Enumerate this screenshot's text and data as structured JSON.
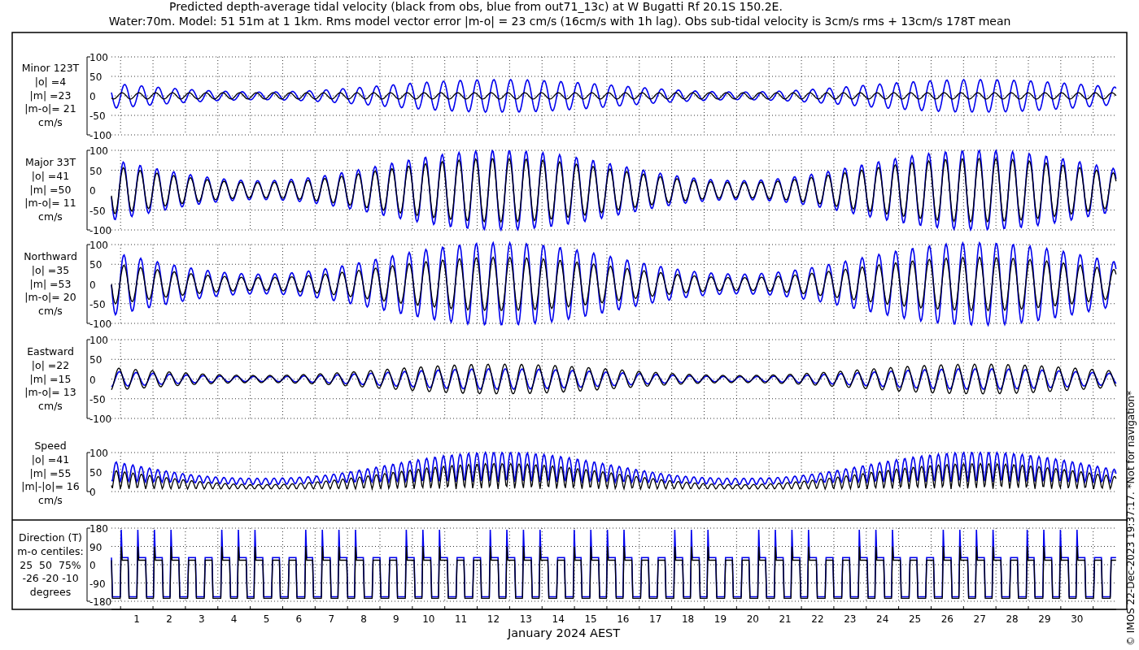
{
  "title": {
    "line_1": "Predicted depth-average tidal velocity (black from obs, blue from out71_13c) at W Bugatti Rf 20.1S 150.2E.",
    "line_2": "Water:70m. Model: 51 51m at 1 1km. Rms model vector error |m-o| = 23 cm/s (16cm/s with 1h lag). Obs sub-tidal velocity is 3cm/s rms + 13cm/s 178T mean"
  },
  "panels": [
    {
      "kind": "signed",
      "label_lines": [
        "Minor 123T",
        "|o| =4",
        "|m| =23",
        "|m-o|= 21",
        "cm/s"
      ],
      "yticks": [
        "100",
        "50",
        "0",
        "-50",
        "-100"
      ]
    },
    {
      "kind": "signed",
      "label_lines": [
        "Major 33T",
        "|o| =41",
        "|m| =50",
        "|m-o|= 11",
        "cm/s"
      ],
      "yticks": [
        "100",
        "50",
        "0",
        "-50",
        "-100"
      ]
    },
    {
      "kind": "signed",
      "label_lines": [
        "Northward",
        "|o| =35",
        "|m| =53",
        "|m-o|= 20",
        "cm/s"
      ],
      "yticks": [
        "100",
        "50",
        "0",
        "-50",
        "-100"
      ]
    },
    {
      "kind": "signed",
      "label_lines": [
        "Eastward",
        "|o| =22",
        "|m| =15",
        "|m-o|= 13",
        "cm/s"
      ],
      "yticks": [
        "100",
        "50",
        "0",
        "-50",
        "-100"
      ]
    },
    {
      "kind": "speed",
      "label_lines": [
        "Speed",
        "|o| =41",
        "|m| =55",
        "|m|-|o|= 16",
        "cm/s"
      ],
      "yticks": [
        "100",
        "50",
        "0"
      ]
    },
    {
      "kind": "direction",
      "label_lines": [
        "Direction (T)",
        "m-o centiles:",
        "25  50  75%",
        "-26 -20 -10",
        "degrees"
      ],
      "yticks": [
        "180",
        "90",
        "0",
        "-90",
        "-180"
      ]
    }
  ],
  "xaxis": {
    "ticks": [
      "1",
      "2",
      "3",
      "4",
      "5",
      "6",
      "7",
      "8",
      "9",
      "10",
      "11",
      "12",
      "13",
      "14",
      "15",
      "16",
      "17",
      "18",
      "19",
      "20",
      "21",
      "22",
      "23",
      "24",
      "25",
      "26",
      "27",
      "28",
      "29",
      "30"
    ],
    "label": "January 2024 AEST"
  },
  "imprint": "© IMOS 22-Dec-2023 19:37:17. *Not for navigation*"
}
